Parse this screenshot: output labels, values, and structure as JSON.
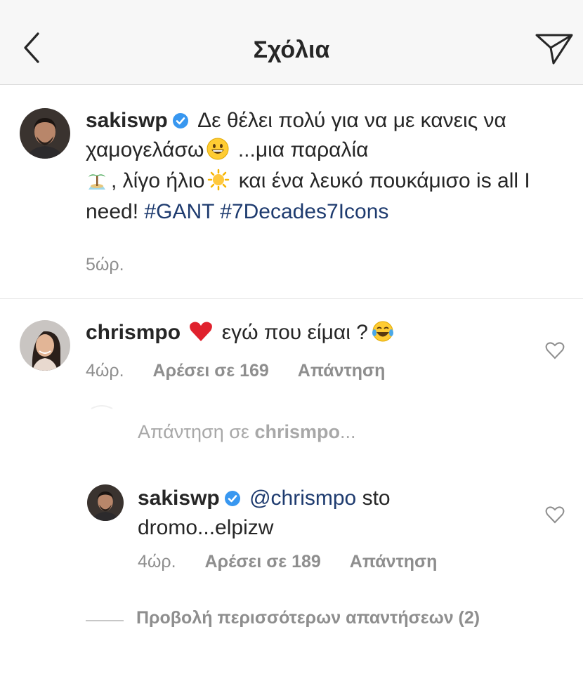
{
  "header": {
    "title": "Σχόλια",
    "back_icon": "chevron-left-icon",
    "share_icon": "paper-plane-icon"
  },
  "caption": {
    "username": "sakiswp",
    "verified_icon": "verified-badge-icon",
    "text_1": "Δε θέλει πολύ για να με κανεις να χαμογελάσω",
    "emoji_1": "grinning-face-emoji",
    "text_2": "...μια παραλία",
    "emoji_2": "desert-island-emoji",
    "text_3": ", λίγο ήλιο",
    "emoji_3": "sun-emoji",
    "text_4": "και ένα λευκό πουκάμισο is all I need!",
    "hashtag_1": "#GANT",
    "hashtag_2": "#7Decades7Icons",
    "time": "5ώρ."
  },
  "comment": {
    "username": "chrismpo",
    "emoji_1": "red-heart-emoji",
    "text": "εγώ που είμαι ?",
    "emoji_2": "tears-of-joy-emoji",
    "time": "4ώρ.",
    "likes": "Αρέσει σε 169",
    "reply_label": "Απάντηση",
    "like_icon": "heart-outline-icon"
  },
  "reply_prompt": {
    "prefix": "Απάντηση σε",
    "username": "chrismpo",
    "suffix": "..."
  },
  "reply": {
    "username": "sakiswp",
    "verified_icon": "verified-badge-icon",
    "mention": "@chrismpo",
    "text": "sto dromo...elpizw",
    "time": "4ώρ.",
    "likes": "Αρέσει σε 189",
    "reply_label": "Απάντηση",
    "like_icon": "heart-outline-icon"
  },
  "view_more": {
    "label": "Προβολή περισσότερων απαντήσεων (2)"
  },
  "colors": {
    "header_bg": "#f7f7f7",
    "text": "#262626",
    "secondary_text": "#8e8e8e",
    "hashtag": "#1e3b6f",
    "verified": "#3897f0",
    "heart_emoji": "#e0212d"
  }
}
